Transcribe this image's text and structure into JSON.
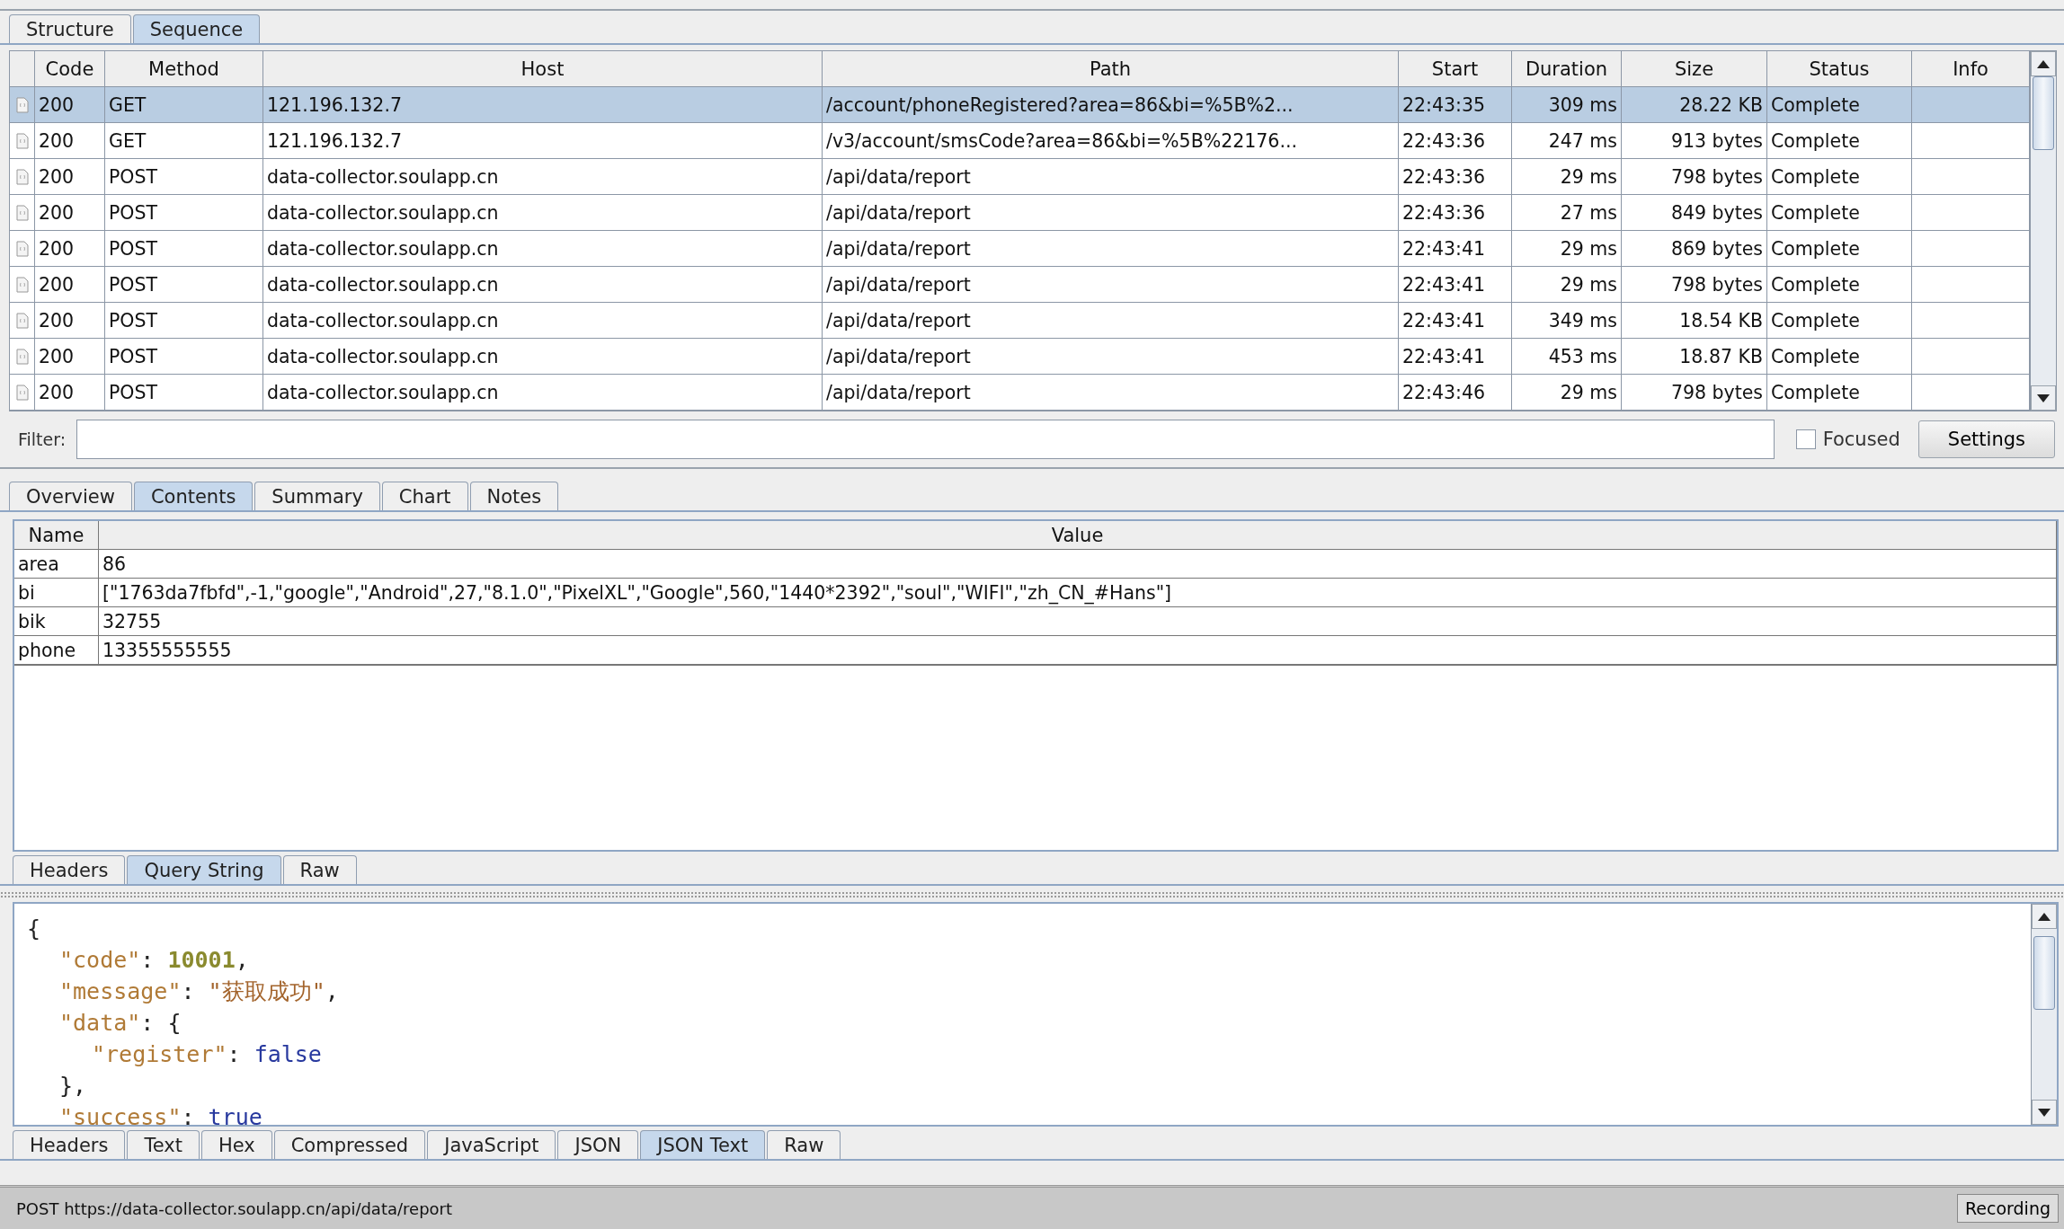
{
  "top_tabs": [
    {
      "label": "Structure",
      "selected": false
    },
    {
      "label": "Sequence",
      "selected": true
    }
  ],
  "table": {
    "columns": [
      {
        "label": "Code"
      },
      {
        "label": "Method"
      },
      {
        "label": "Host"
      },
      {
        "label": "Path"
      },
      {
        "label": "Start"
      },
      {
        "label": "Duration"
      },
      {
        "label": "Size"
      },
      {
        "label": "Status"
      },
      {
        "label": "Info"
      }
    ],
    "rows": [
      {
        "selected": true,
        "cells": [
          "200",
          "GET",
          "121.196.132.7",
          "/account/phoneRegistered?area=86&bi=%5B%2...",
          "22:43:35",
          "309 ms",
          "28.22 KB",
          "Complete",
          ""
        ]
      },
      {
        "selected": false,
        "cells": [
          "200",
          "GET",
          "121.196.132.7",
          "/v3/account/smsCode?area=86&bi=%5B%22176...",
          "22:43:36",
          "247 ms",
          "913 bytes",
          "Complete",
          ""
        ]
      },
      {
        "selected": false,
        "cells": [
          "200",
          "POST",
          "data-collector.soulapp.cn",
          "/api/data/report",
          "22:43:36",
          "29 ms",
          "798 bytes",
          "Complete",
          ""
        ]
      },
      {
        "selected": false,
        "cells": [
          "200",
          "POST",
          "data-collector.soulapp.cn",
          "/api/data/report",
          "22:43:36",
          "27 ms",
          "849 bytes",
          "Complete",
          ""
        ]
      },
      {
        "selected": false,
        "cells": [
          "200",
          "POST",
          "data-collector.soulapp.cn",
          "/api/data/report",
          "22:43:41",
          "29 ms",
          "869 bytes",
          "Complete",
          ""
        ]
      },
      {
        "selected": false,
        "cells": [
          "200",
          "POST",
          "data-collector.soulapp.cn",
          "/api/data/report",
          "22:43:41",
          "29 ms",
          "798 bytes",
          "Complete",
          ""
        ]
      },
      {
        "selected": false,
        "cells": [
          "200",
          "POST",
          "data-collector.soulapp.cn",
          "/api/data/report",
          "22:43:41",
          "349 ms",
          "18.54 KB",
          "Complete",
          ""
        ]
      },
      {
        "selected": false,
        "cells": [
          "200",
          "POST",
          "data-collector.soulapp.cn",
          "/api/data/report",
          "22:43:41",
          "453 ms",
          "18.87 KB",
          "Complete",
          ""
        ]
      },
      {
        "selected": false,
        "cells": [
          "200",
          "POST",
          "data-collector.soulapp.cn",
          "/api/data/report",
          "22:43:46",
          "29 ms",
          "798 bytes",
          "Complete",
          ""
        ]
      }
    ]
  },
  "filter": {
    "label": "Filter:",
    "focused": {
      "label": "Focused",
      "checked": false
    },
    "settings": "Settings"
  },
  "detail_tabs": [
    {
      "label": "Overview",
      "selected": false
    },
    {
      "label": "Contents",
      "selected": true
    },
    {
      "label": "Summary",
      "selected": false
    },
    {
      "label": "Chart",
      "selected": false
    },
    {
      "label": "Notes",
      "selected": false
    }
  ],
  "params": {
    "columns": [
      "Name",
      "Value"
    ],
    "rows": [
      [
        "area",
        "86"
      ],
      [
        "bi",
        "[\"1763da7fbfd\",-1,\"google\",\"Android\",27,\"8.1.0\",\"PixelXL\",\"Google\",560,\"1440*2392\",\"soul\",\"WIFI\",\"zh_CN_#Hans\"]"
      ],
      [
        "bik",
        "32755"
      ],
      [
        "phone",
        "13355555555"
      ]
    ]
  },
  "request_tabs": [
    {
      "label": "Headers",
      "selected": false
    },
    {
      "label": "Query String",
      "selected": true
    },
    {
      "label": "Raw",
      "selected": false
    }
  ],
  "response_json": [
    {
      "tokens": [
        {
          "kind": "punct",
          "text": "{"
        }
      ],
      "children": [
        {
          "tokens": [
            {
              "kind": "key",
              "text": "\"code\""
            },
            {
              "kind": "punct",
              "text": ": "
            },
            {
              "kind": "number",
              "text": "10001"
            },
            {
              "kind": "punct",
              "text": ","
            }
          ]
        },
        {
          "tokens": [
            {
              "kind": "key",
              "text": "\"message\""
            },
            {
              "kind": "punct",
              "text": ": "
            },
            {
              "kind": "string",
              "text": "\"获取成功\""
            },
            {
              "kind": "punct",
              "text": ","
            }
          ]
        },
        {
          "tokens": [
            {
              "kind": "key",
              "text": "\"data\""
            },
            {
              "kind": "punct",
              "text": ": {"
            }
          ],
          "children": [
            {
              "tokens": [
                {
                  "kind": "key",
                  "text": "\"register\""
                },
                {
                  "kind": "punct",
                  "text": ": "
                },
                {
                  "kind": "keyword",
                  "text": "false"
                }
              ]
            }
          ]
        },
        {
          "tokens": [
            {
              "kind": "punct",
              "text": "},"
            }
          ]
        },
        {
          "tokens": [
            {
              "kind": "key",
              "text": "\"success\""
            },
            {
              "kind": "punct",
              "text": ": "
            },
            {
              "kind": "keyword",
              "text": "true"
            }
          ]
        }
      ]
    }
  ],
  "response_tabs": [
    {
      "label": "Headers",
      "selected": false
    },
    {
      "label": "Text",
      "selected": false
    },
    {
      "label": "Hex",
      "selected": false
    },
    {
      "label": "Compressed",
      "selected": false
    },
    {
      "label": "JavaScript",
      "selected": false
    },
    {
      "label": "JSON",
      "selected": false
    },
    {
      "label": "JSON Text",
      "selected": true
    },
    {
      "label": "Raw",
      "selected": false
    }
  ],
  "status_bar": {
    "text": "POST https://data-collector.soulapp.cn/api/data/report",
    "button": "Recording"
  }
}
